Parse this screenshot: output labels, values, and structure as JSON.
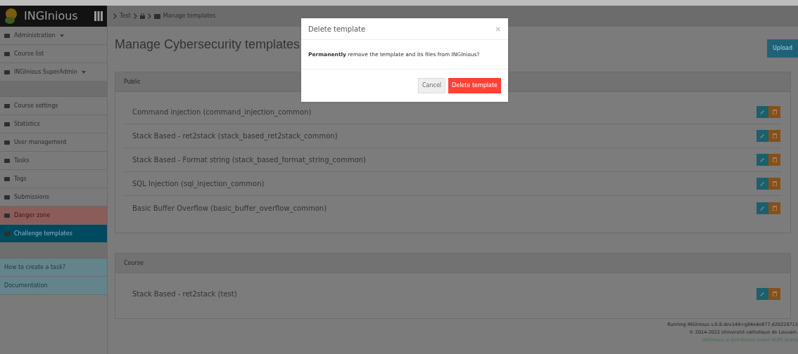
{
  "brand": "INGInious",
  "breadcrumb": [
    {
      "kind": "text",
      "label": "Test"
    },
    {
      "kind": "icon"
    },
    {
      "kind": "current",
      "label": "Manage templates"
    }
  ],
  "sidebar": {
    "sections": [
      {
        "items": [
          {
            "label": "Administration",
            "kind": "dropdown",
            "selected": false
          },
          {
            "label": "Course list",
            "kind": "normal",
            "selected": false
          },
          {
            "label": "INGInious SuperAdmin",
            "kind": "dropdown",
            "selected": false
          }
        ]
      },
      {
        "items": [
          {
            "label": "Course settings",
            "kind": "normal",
            "selected": false
          },
          {
            "label": "Statistics",
            "kind": "normal",
            "selected": false
          },
          {
            "label": "User management",
            "kind": "normal",
            "selected": false
          },
          {
            "label": "Tasks",
            "kind": "normal",
            "selected": false
          },
          {
            "label": "Tags",
            "kind": "normal",
            "selected": false
          },
          {
            "label": "Submissions",
            "kind": "normal",
            "selected": false
          },
          {
            "label": "Danger zone",
            "kind": "danger",
            "selected": false
          },
          {
            "label": "Challenge templates",
            "kind": "normal",
            "selected": true
          }
        ]
      },
      {
        "items": [
          {
            "label": "How to create a task?",
            "kind": "help",
            "selected": false
          },
          {
            "label": "Documentation",
            "kind": "help",
            "selected": false
          }
        ]
      }
    ]
  },
  "page_title": "Manage Cybersecurity templates",
  "upload_button": "Upload",
  "panels": [
    {
      "title": "Public",
      "templates": [
        "Command injection (command_injection_common)",
        "Stack Based - ret2stack (stack_based_ret2stack_common)",
        "Stack Based - Format string (stack_based_format_string_common)",
        "SQL Injection (sql_injection_common)",
        "Basic Buffer Overflow (basic_buffer_overflow_common)"
      ]
    },
    {
      "title": "Course",
      "templates": [
        "Stack Based - ret2stack (test)"
      ]
    }
  ],
  "footer": {
    "version": "Running INGInious v.0.8.dev149+g84e4e877.d20220713",
    "copyright": "© 2014-2022 Université catholique de Louvain.",
    "license": "INGInious is distributed under AGPL licens"
  },
  "modal": {
    "title": "Delete template",
    "close": "×",
    "message": "**Permanently** remove the template and its files from INGInious?",
    "cancel": "Cancel",
    "confirm": "Delete template"
  }
}
